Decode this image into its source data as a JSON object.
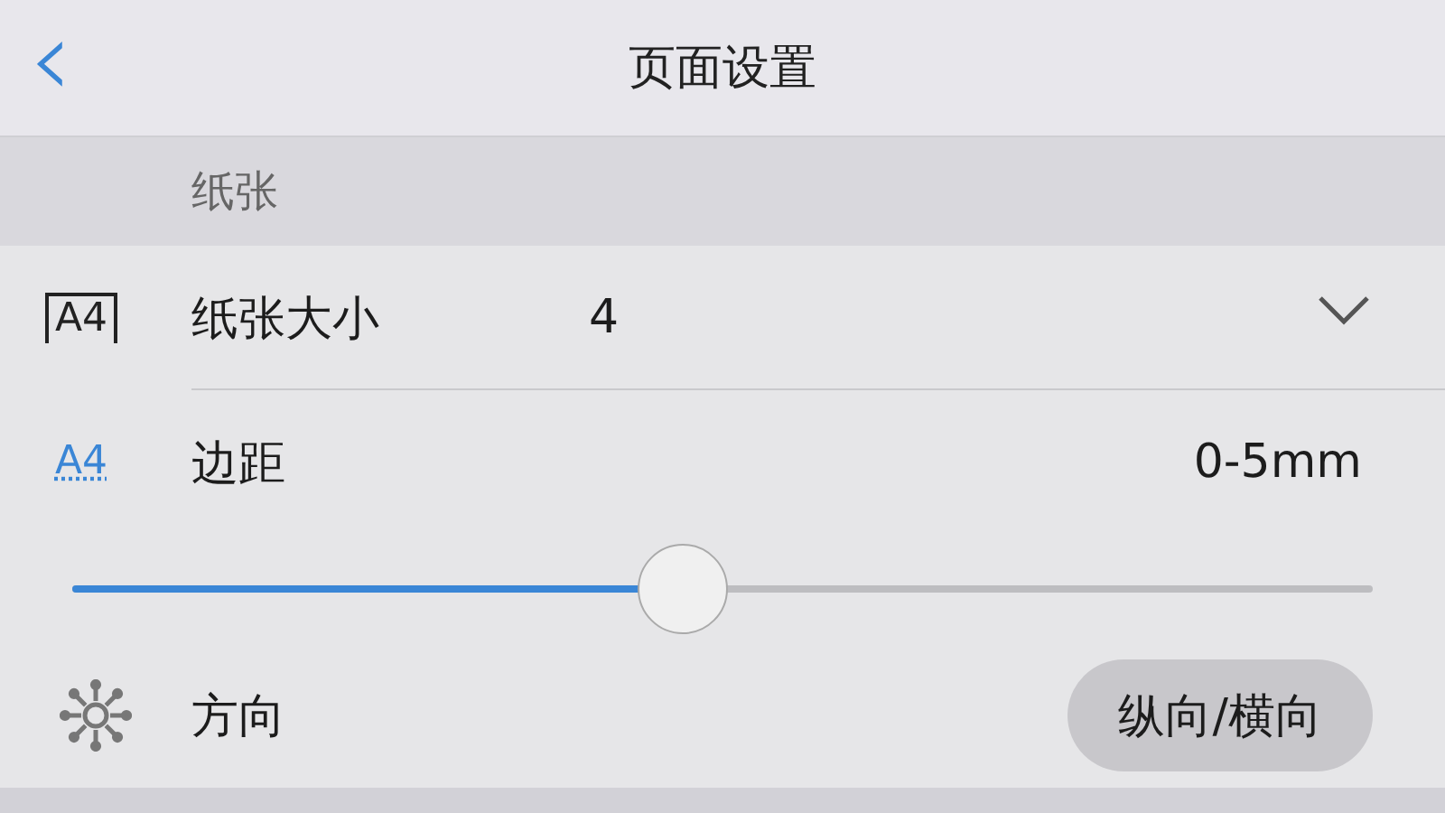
{
  "navbar": {
    "back_icon": "‹",
    "title": "页面设置"
  },
  "section": {
    "title": "纸张"
  },
  "rows": [
    {
      "kind": "select",
      "icon": "A4",
      "label": "纸张大小",
      "value": "4",
      "expanded": false
    },
    {
      "kind": "slider",
      "icon": "A4",
      "label": "边距",
      "reading": "0-5mm",
      "level": 0.47
    },
    {
      "kind": "button",
      "label": "方向",
      "button": "纵向/横向"
    }
  ]
}
